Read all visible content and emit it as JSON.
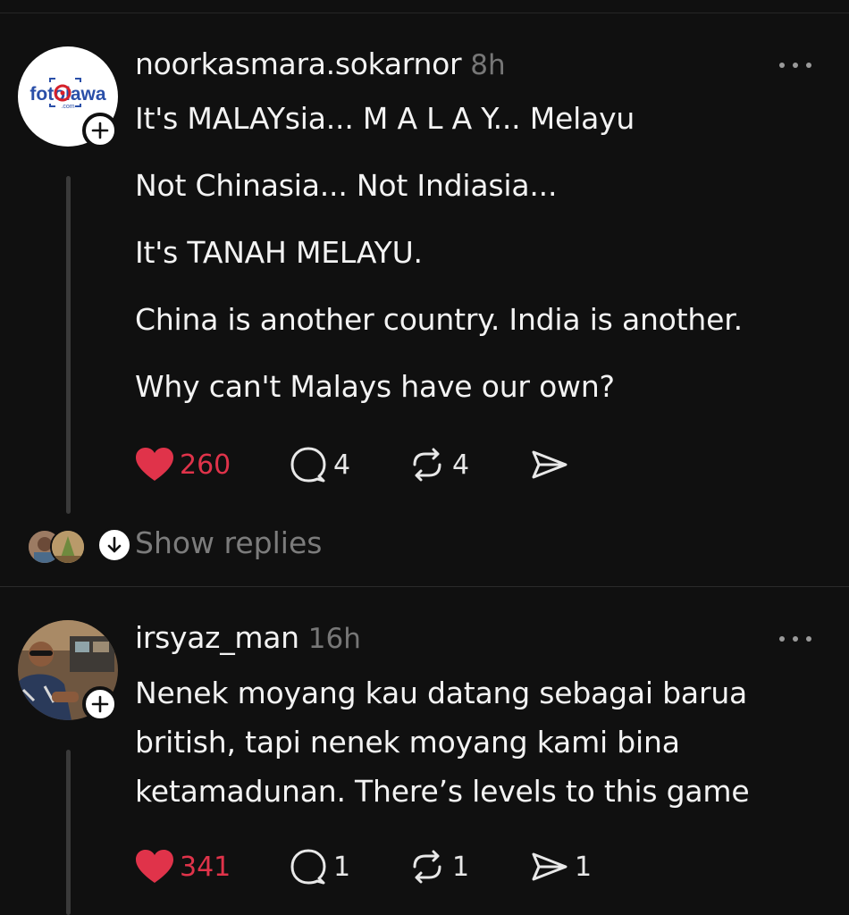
{
  "posts": [
    {
      "username": "noorkasmara.sokarnor",
      "time": "8h",
      "avatar_logo_text": "fotolawa",
      "avatar_logo_sub": ".com",
      "paragraphs": [
        "It's MALAYsia... M A L A Y... Melayu",
        "Not Chinasia... Not Indiasia...",
        "It's TANAH MELAYU.",
        "China is another country. India is another.",
        "Why can't Malays have our own?"
      ],
      "likes": "260",
      "comments": "4",
      "reposts": "4",
      "shares": "",
      "show_replies": "Show replies"
    },
    {
      "username": "irsyaz_man",
      "time": "16h",
      "text": "Nenek moyang kau datang sebagai barua british, tapi nenek moyang kami bina ketamadunan. There’s levels to this game",
      "likes": "341",
      "comments": "1",
      "reposts": "1",
      "shares": "1"
    }
  ],
  "icons": {
    "like": "heart-icon",
    "comment": "comment-icon",
    "repost": "repost-icon",
    "share": "send-icon",
    "more": "more-options-icon",
    "follow": "plus-icon",
    "expand": "arrow-down-icon"
  },
  "colors": {
    "background": "#101010",
    "like": "#e0334a",
    "muted": "#777777",
    "text": "#f3f3f3"
  }
}
